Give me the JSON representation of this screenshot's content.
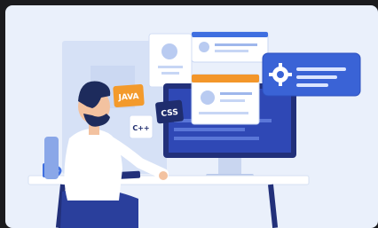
{
  "illustration": {
    "topic": "developer-at-computer",
    "badges": {
      "java": "JAVA",
      "css": "CSS",
      "cpp": "C++"
    },
    "icons": [
      "settings-gear-icon",
      "user-avatar-icon"
    ],
    "colors": {
      "background": "#eaf0fb",
      "accent_blue": "#3f6fe0",
      "dark_navy": "#1f2d6e",
      "orange": "#f3962a",
      "skin": "#f3c2a0",
      "hair": "#1d2b5c"
    }
  }
}
